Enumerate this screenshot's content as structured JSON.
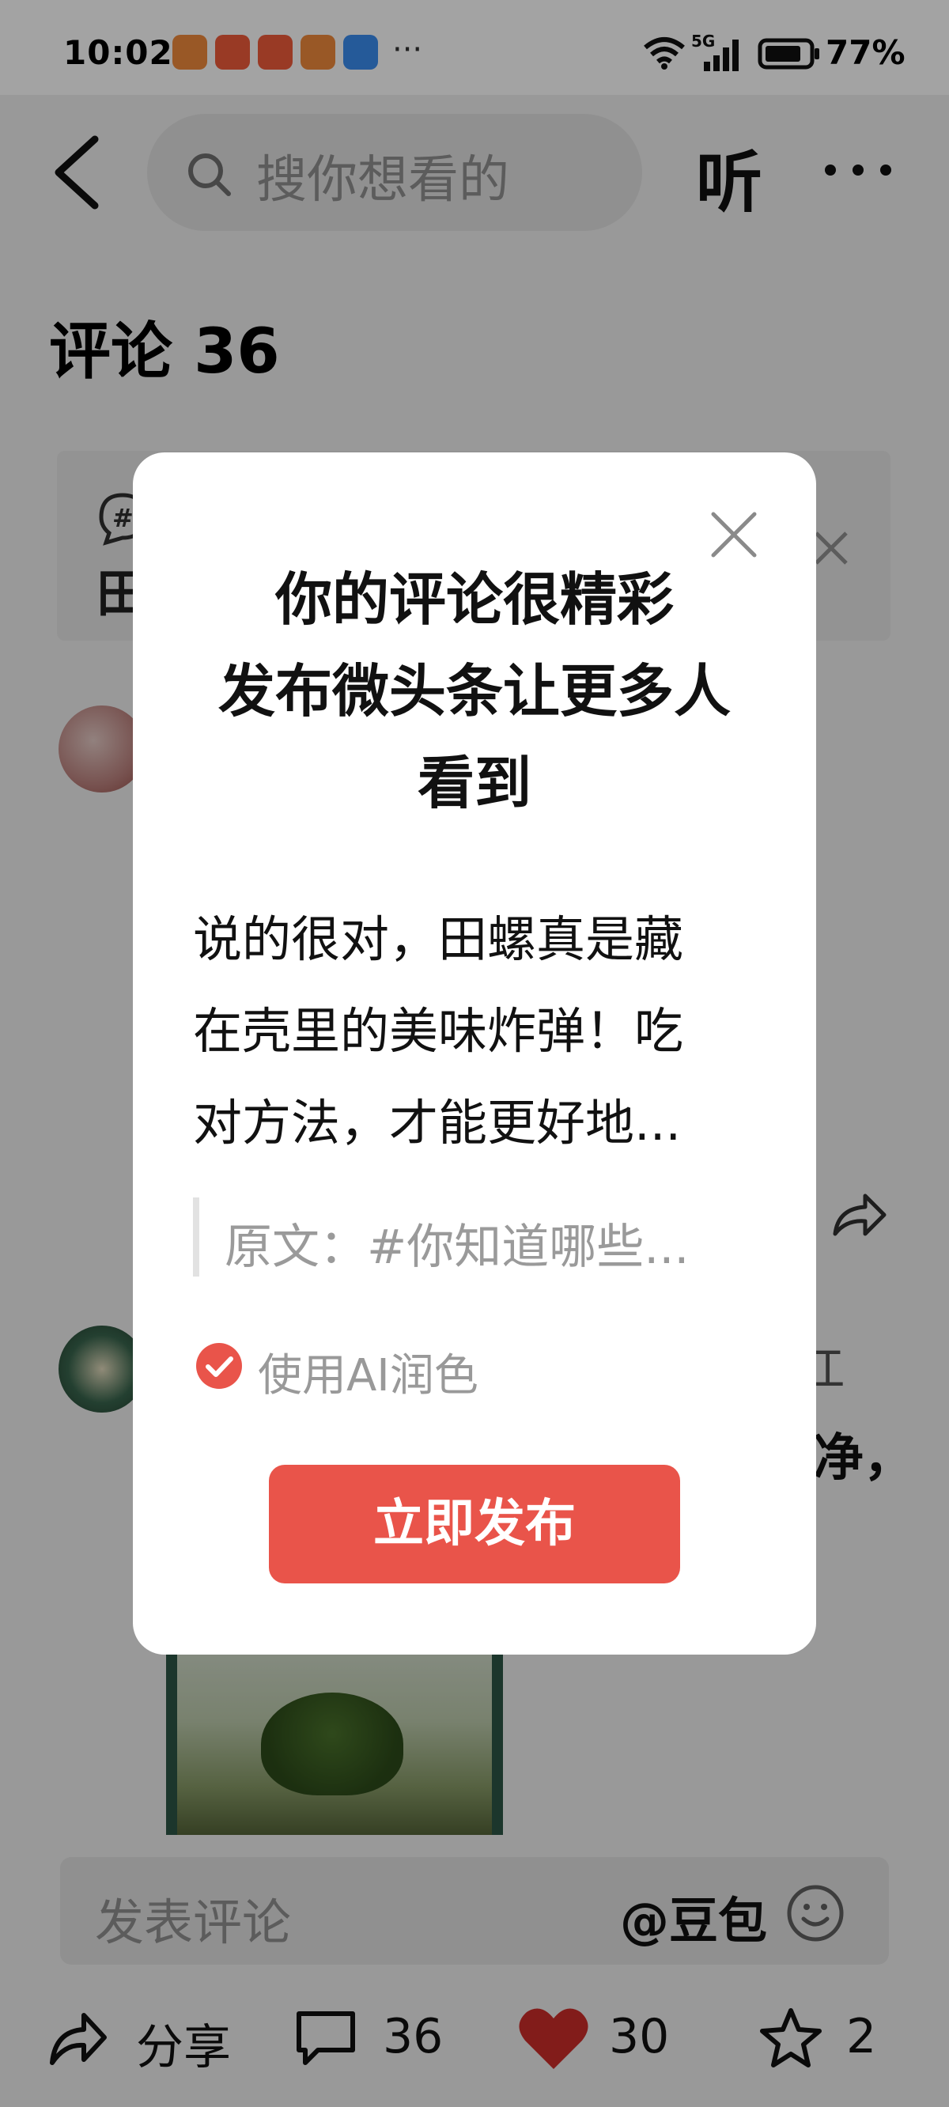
{
  "status_bar": {
    "time": "10:02",
    "network": "5G",
    "battery": "77%",
    "more_dots": "···"
  },
  "nav": {
    "search_placeholder": "搜你想看的",
    "listen_label": "听"
  },
  "comments": {
    "title": "评论 36"
  },
  "background": {
    "topic_first_char": "田",
    "text_jiang": "江",
    "text_zheng": "净，"
  },
  "comment_input": {
    "placeholder": "发表评论",
    "mention": "@豆包"
  },
  "bottom_bar": {
    "share_label": "分享",
    "comment_count": "36",
    "like_count": "30",
    "favorite_count": "2"
  },
  "dialog": {
    "title_lines": [
      "你的评论很精彩",
      "发布微头条让更多人",
      "看到"
    ],
    "comment_lines": [
      "说的很对，田螺真是藏",
      "在壳里的美味炸弹！吃",
      "对方法，才能更好地..."
    ],
    "quote": "原文：#你知道哪些...",
    "ai_polish_label": "使用AI润色",
    "ai_polish_checked": true,
    "publish_label": "立即发布"
  },
  "colors": {
    "accent_red": "#e9544a",
    "like_red": "#d9302c"
  },
  "icons": [
    "back-icon",
    "search-icon",
    "more-icon",
    "close-icon",
    "share-icon",
    "comment-icon",
    "heart-icon",
    "star-icon",
    "emoji-icon",
    "check-icon"
  ]
}
